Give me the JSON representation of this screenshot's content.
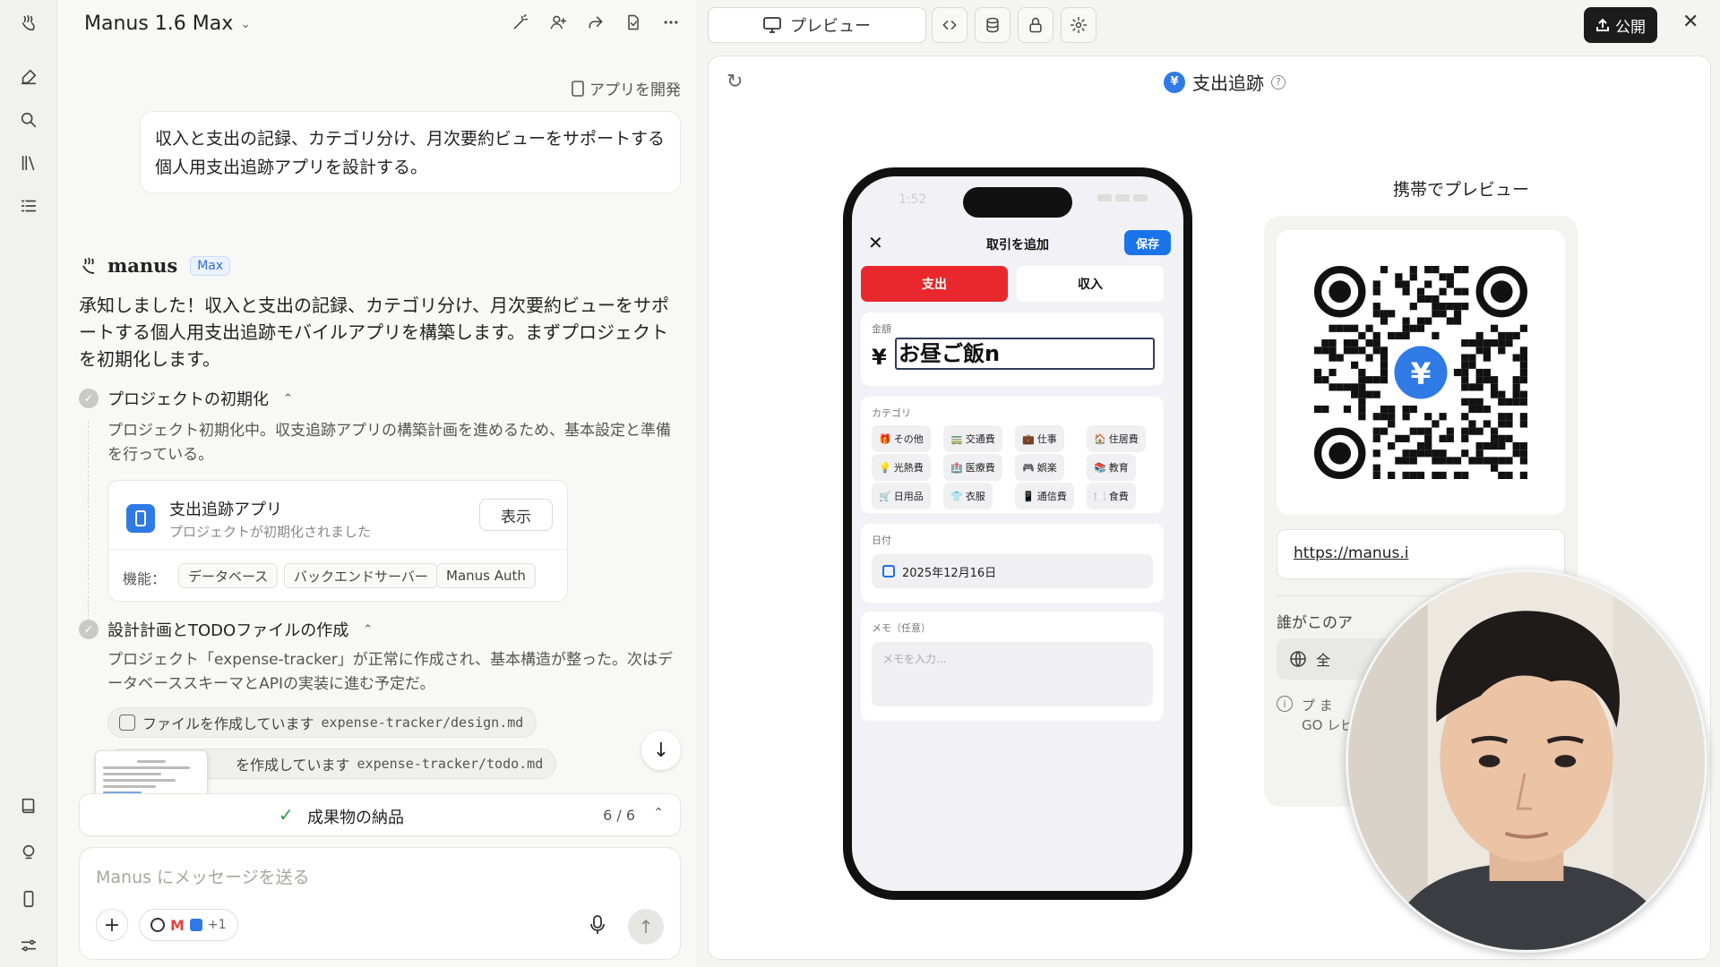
{
  "chat": {
    "model_title": "Manus 1.6 Max",
    "dev_link": "アプリを開発",
    "user_message": "収入と支出の記録、カテゴリ分け、月次要約ビューをサポートする個人用支出追跡アプリを設計する。",
    "agent_name": "manus",
    "agent_badge": "Max",
    "reply": "承知しました！収入と支出の記録、カテゴリ分け、月次要約ビューをサポートする個人用支出追跡モバイルアプリを構築します。まずプロジェクトを初期化します。",
    "step1": {
      "title": "プロジェクトの初期化",
      "desc": "プロジェクト初期化中。収支追跡アプリの構築計画を進めるため、基本設定と準備を行っている。"
    },
    "project_card": {
      "name": "支出追跡アプリ",
      "sub": "プロジェクトが初期化されました",
      "view_label": "表示",
      "features_label": "機能：",
      "features": [
        "データベース",
        "バックエンドサーバー",
        "Manus Auth"
      ]
    },
    "step2": {
      "title": "設計計画とTODOファイルの作成",
      "desc": "プロジェクト「expense-tracker」が正常に作成され、基本構造が整った。次はデータベーススキーマとAPIの実装に進む予定だ。"
    },
    "file1": {
      "label": "ファイルを作成しています",
      "path": "expense-tracker/design.md"
    },
    "file2": {
      "label": "を作成しています",
      "path": "expense-tracker/todo.md"
    },
    "deliver": {
      "label": "成果物の納品",
      "count": "6 / 6"
    },
    "composer": {
      "placeholder": "Manus にメッセージを送る",
      "tools_more": "+1"
    }
  },
  "toolbar": {
    "preview_label": "プレビュー",
    "publish_label": "公開"
  },
  "preview": {
    "app_title": "支出追跡",
    "phone": {
      "time": "1:52",
      "header_title": "取引を追加",
      "save": "保存",
      "tab_expense": "支出",
      "tab_income": "収入",
      "amount_label": "金額",
      "currency": "¥",
      "amount_value": "お昼ご飯n",
      "category_label": "カテゴリ",
      "categories": [
        {
          "icon": "🎁",
          "label": "その他"
        },
        {
          "icon": "🚃",
          "label": "交通費"
        },
        {
          "icon": "💼",
          "label": "仕事"
        },
        {
          "icon": "🏠",
          "label": "住居費"
        },
        {
          "icon": "💡",
          "label": "光熱費"
        },
        {
          "icon": "🏥",
          "label": "医療費"
        },
        {
          "icon": "🎮",
          "label": "娯楽"
        },
        {
          "icon": "📚",
          "label": "教育"
        },
        {
          "icon": "🛒",
          "label": "日用品"
        },
        {
          "icon": "👕",
          "label": "衣服"
        },
        {
          "icon": "📱",
          "label": "通信費"
        },
        {
          "icon": "🍽️",
          "label": "食費"
        }
      ],
      "date_label": "日付",
      "date_value": "2025年12月16日",
      "memo_label": "メモ（任意）",
      "memo_placeholder": "メモを入力..."
    },
    "mobile_title": "携帯でプレビュー",
    "url": "https://manus.i",
    "who_label": "誰がこのア",
    "access": "全",
    "info_text": "プ ま GO レビ"
  },
  "colors": {
    "expense": "#e8282c",
    "save": "#1a73e8",
    "brand": "#2f7ae5"
  }
}
